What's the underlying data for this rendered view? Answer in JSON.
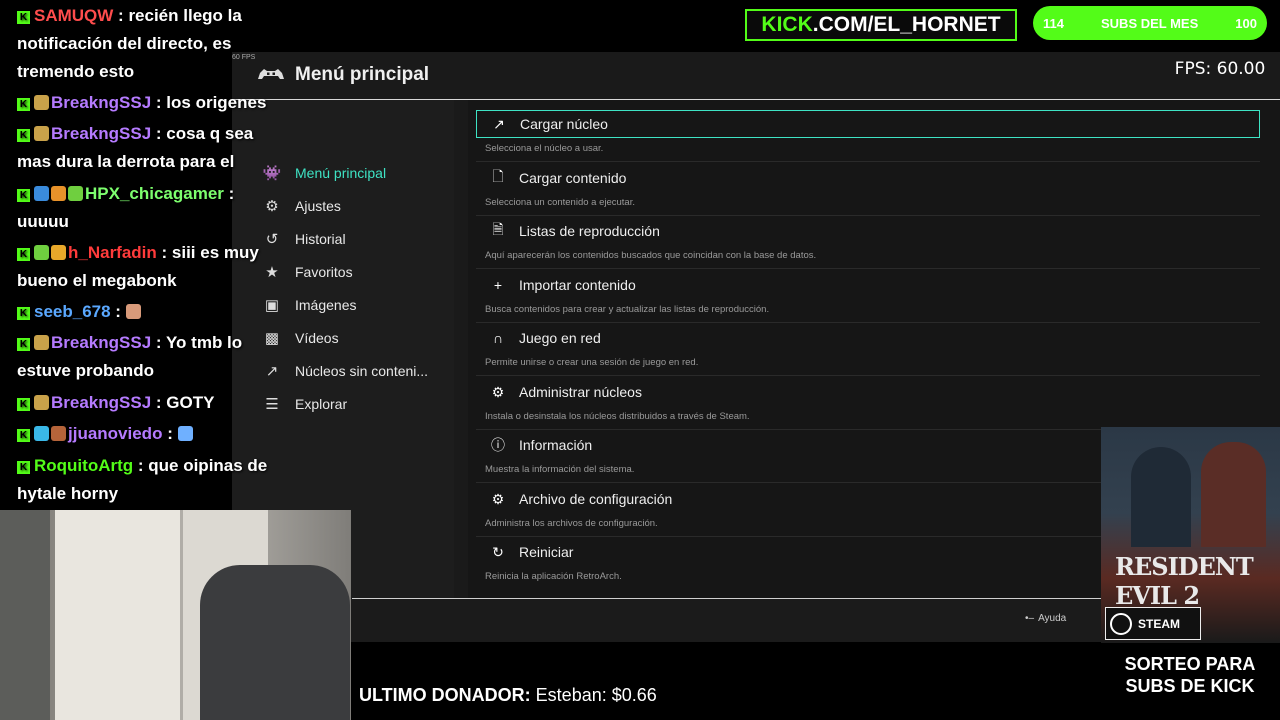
{
  "chat": {
    "messages": [
      {
        "user": "SAMUQW",
        "user_color": "#ff4d4d",
        "text": "recién llego la notificación del directo, es tremendo esto"
      },
      {
        "user": "BreakngSSJ",
        "user_color": "#b57bff",
        "text": "los origenes"
      },
      {
        "user": "BreakngSSJ",
        "user_color": "#b57bff",
        "text": "cosa q sea mas dura la derrota para el"
      },
      {
        "user": "HPX_chicagamer",
        "user_color": "#7dff6e",
        "text": "uuuuu"
      },
      {
        "user": "h_Narfadin",
        "user_color": "#ff3b3b",
        "text": "siii es muy bueno el megabonk"
      },
      {
        "user": "seeb_678",
        "user_color": "#5aa8ff",
        "text": ""
      },
      {
        "user": "BreakngSSJ",
        "user_color": "#b57bff",
        "text": "Yo tmb lo estuve probando"
      },
      {
        "user": "BreakngSSJ",
        "user_color": "#b57bff",
        "text": "GOTY"
      },
      {
        "user": "jjuanoviedo",
        "user_color": "#b57bff",
        "text": ""
      },
      {
        "user": "RoquitoArtg",
        "user_color": "#53fc18",
        "text": "que oipinas de hytale horny"
      }
    ]
  },
  "kick_banner": {
    "brand": "KICK",
    "rest": ".COM/EL_HORNET"
  },
  "subs": {
    "current": "114",
    "label": "SUBS DEL MES",
    "goal": "100"
  },
  "fps_overlay": {
    "label": "FPS:",
    "value": "60.00"
  },
  "retroarch": {
    "fps_small": "60 FPS",
    "title": "Menú principal",
    "sidebar": [
      {
        "label": "Menú principal",
        "icon": "invader-icon",
        "active": true
      },
      {
        "label": "Ajustes",
        "icon": "gear-icon",
        "active": false
      },
      {
        "label": "Historial",
        "icon": "history-icon",
        "active": false
      },
      {
        "label": "Favoritos",
        "icon": "star-icon",
        "active": false
      },
      {
        "label": "Imágenes",
        "icon": "image-icon",
        "active": false
      },
      {
        "label": "Vídeos",
        "icon": "video-icon",
        "active": false
      },
      {
        "label": "Núcleos sin conteni...",
        "icon": "rocket-icon",
        "active": false
      },
      {
        "label": "Explorar",
        "icon": "database-icon",
        "active": false
      }
    ],
    "items": [
      {
        "label": "Cargar núcleo",
        "desc": "Selecciona el núcleo a usar.",
        "icon": "rocket-icon"
      },
      {
        "label": "Cargar contenido",
        "desc": "Selecciona un contenido a ejecutar.",
        "icon": "file-icon"
      },
      {
        "label": "Listas de reproducción",
        "desc": "Aquí aparecerán los contenidos buscados que coincidan con la base de datos.",
        "icon": "playlist-file-icon"
      },
      {
        "label": "Importar contenido",
        "desc": "Busca contenidos para crear y actualizar las listas de reproducción.",
        "icon": "plus-icon"
      },
      {
        "label": "Juego en red",
        "desc": "Permite unirse o crear una sesión de juego en red.",
        "icon": "headset-icon"
      },
      {
        "label": "Administrar núcleos",
        "desc": "Instala o desinstala los núcleos distribuidos a través de Steam.",
        "icon": "gears-icon"
      },
      {
        "label": "Información",
        "desc": "Muestra la información del sistema.",
        "icon": "info-icon"
      },
      {
        "label": "Archivo de configuración",
        "desc": "Administra los archivos de configuración.",
        "icon": "gears-icon"
      },
      {
        "label": "Reiniciar",
        "desc": "Reinicia la aplicación RetroArch.",
        "icon": "refresh-icon"
      }
    ],
    "footer_help": "Ayuda"
  },
  "re2": {
    "title": "RESIDENT EVIL 2",
    "steam": "STEAM"
  },
  "sorteo": {
    "line1": "SORTEO PARA",
    "line2": "SUBS DE KICK"
  },
  "donor": {
    "label": "ULTIMO DONADOR:",
    "value": "Esteban: $0.66"
  },
  "colors": {
    "accent": "#3ee3c4",
    "kick_green": "#53fc18"
  }
}
